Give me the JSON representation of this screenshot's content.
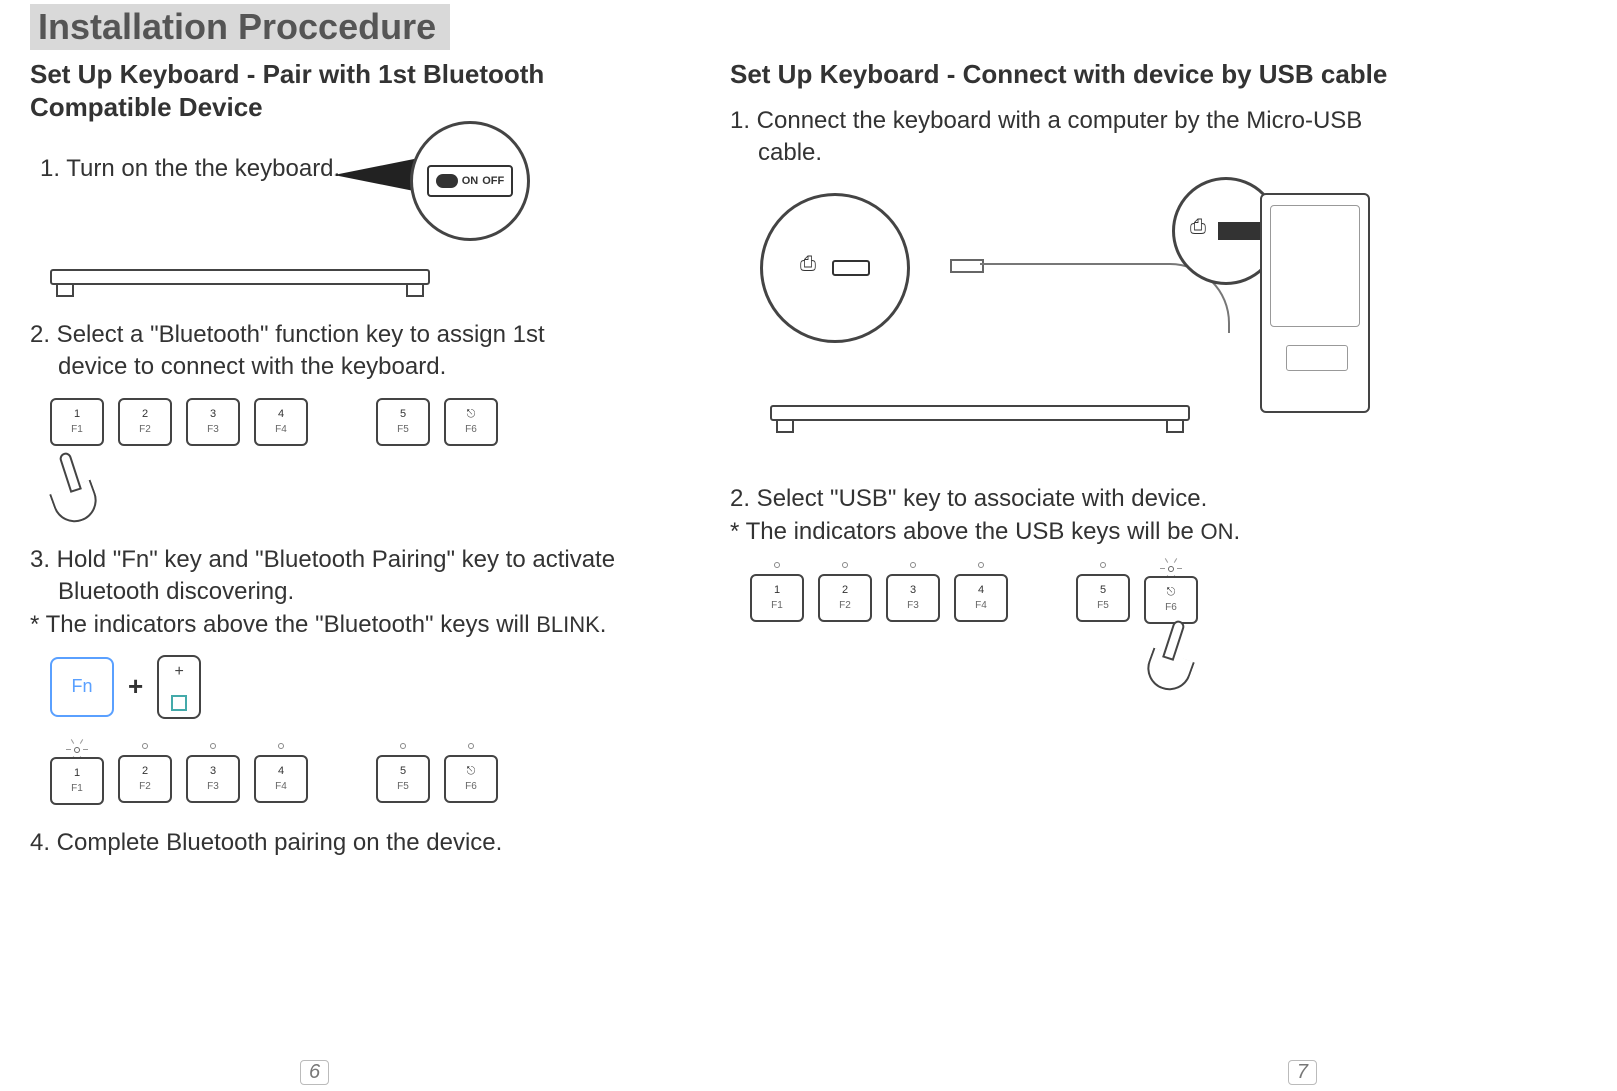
{
  "title": "Installation Proccedure",
  "left": {
    "heading": "Set Up Keyboard - Pair with 1st Bluetooth Compatible Device",
    "step1": "1. Turn on the the keyboard.",
    "switch_on": "ON",
    "switch_off": "OFF",
    "step2_a": "2. Select a \"Bluetooth\" function key to assign 1st",
    "step2_b": "device to connect with the keyboard.",
    "step3_a": "3. Hold \"Fn\" key and \"Bluetooth Pairing\" key to activate",
    "step3_b": "Bluetooth discovering.",
    "step3_note": "* The indicators above the \"Bluetooth\" keys will ",
    "step3_note_em": "BLINK",
    "fn_label": "Fn",
    "plus": "+",
    "pair_plus": "+",
    "step4": "4. Complete Bluetooth pairing on the device.",
    "keys": [
      {
        "top": "1",
        "sub": "F1"
      },
      {
        "top": "2",
        "sub": "F2"
      },
      {
        "top": "3",
        "sub": "F3"
      },
      {
        "top": "4",
        "sub": "F4"
      },
      {
        "top": "5",
        "sub": "F5"
      },
      {
        "top": "⎋",
        "sub": "F6"
      }
    ]
  },
  "right": {
    "heading": "Set Up Keyboard - Connect with device by USB cable",
    "step1_a": "1. Connect the keyboard with a computer by the Micro-USB",
    "step1_b": "cable.",
    "step2": "2. Select \"USB\" key to associate with device.",
    "step2_note": "* The indicators above the USB keys will be ",
    "step2_note_em": "ON",
    "keys": [
      {
        "top": "1",
        "sub": "F1"
      },
      {
        "top": "2",
        "sub": "F2"
      },
      {
        "top": "3",
        "sub": "F3"
      },
      {
        "top": "4",
        "sub": "F4"
      },
      {
        "top": "5",
        "sub": "F5"
      },
      {
        "top": "⎋",
        "sub": "F6"
      }
    ]
  },
  "page_left": "6",
  "page_right": "7"
}
